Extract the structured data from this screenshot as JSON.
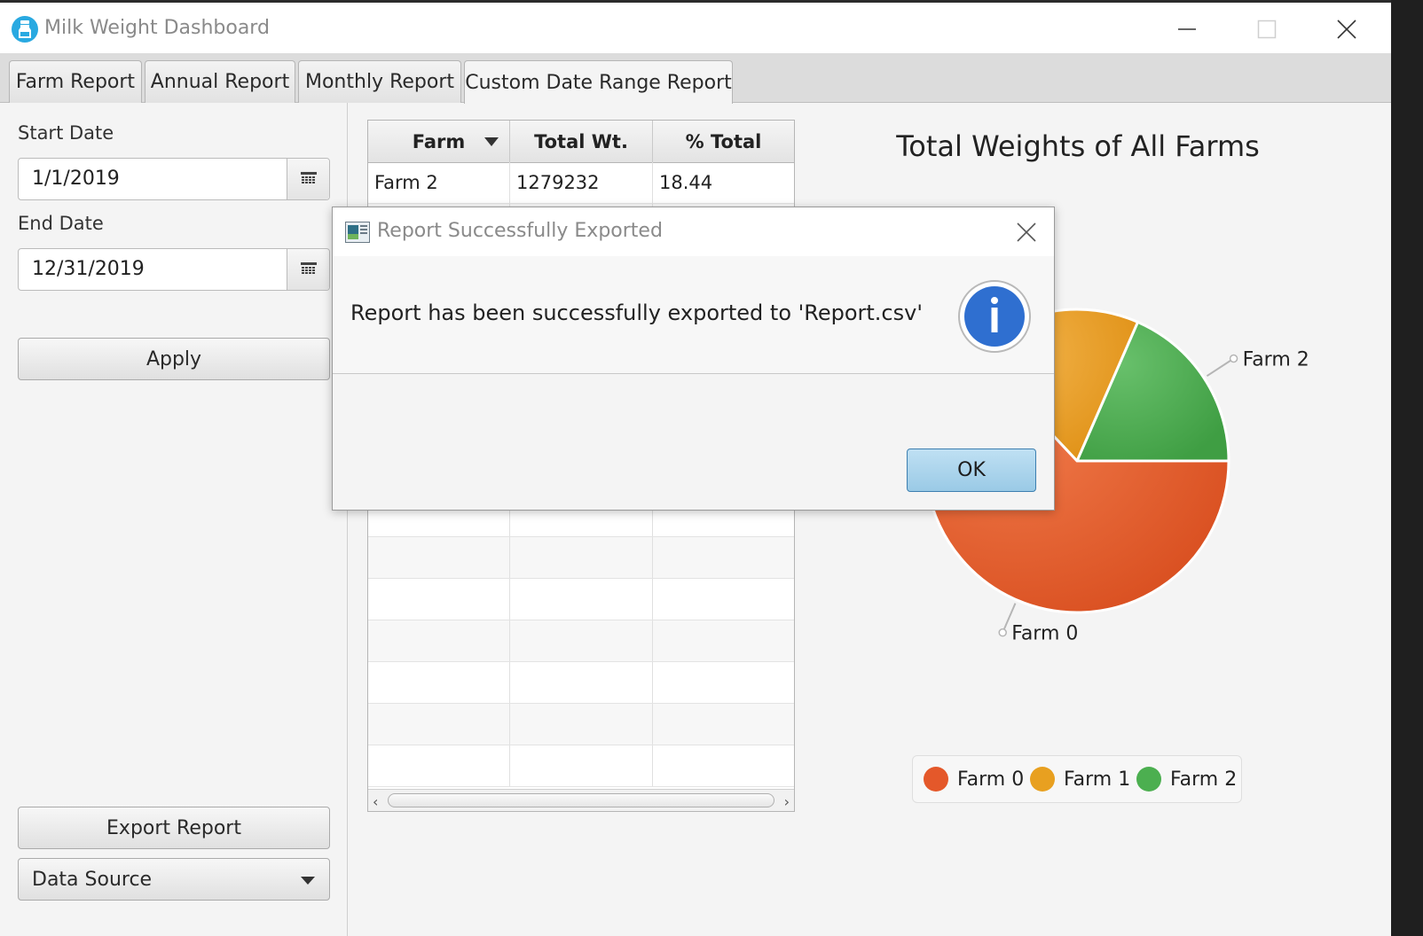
{
  "window": {
    "title": "Milk Weight Dashboard",
    "icon": "milk-bottle-icon"
  },
  "tabs": [
    {
      "label": "Farm Report",
      "active": false
    },
    {
      "label": "Annual Report",
      "active": false
    },
    {
      "label": "Monthly Report",
      "active": false
    },
    {
      "label": "Custom Date Range Report",
      "active": true
    }
  ],
  "left_panel": {
    "start_label": "Start Date",
    "start_value": "1/1/2019",
    "end_label": "End Date",
    "end_value": "12/31/2019",
    "apply_label": "Apply",
    "export_label": "Export Report",
    "data_source_label": "Data Source"
  },
  "table": {
    "columns": [
      "Farm",
      "Total Wt.",
      "% Total"
    ],
    "rows": [
      [
        "Farm 2",
        "1279232",
        "18.44"
      ]
    ]
  },
  "chart_data": {
    "type": "pie",
    "title": "Total Weights of All Farms",
    "labels": [
      "Farm 0",
      "Farm 1",
      "Farm 2"
    ],
    "values": [
      63,
      18.56,
      18.44
    ],
    "colors": [
      "#e4582a",
      "#e8a020",
      "#4caf50"
    ],
    "legend": "bottom",
    "visible_slice_labels": [
      "Farm 0",
      "Farm 2"
    ]
  },
  "dialog": {
    "title": "Report Successfully Exported",
    "message": "Report has been successfully exported to 'Report.csv'",
    "ok_label": "OK",
    "icon": "info-icon"
  }
}
